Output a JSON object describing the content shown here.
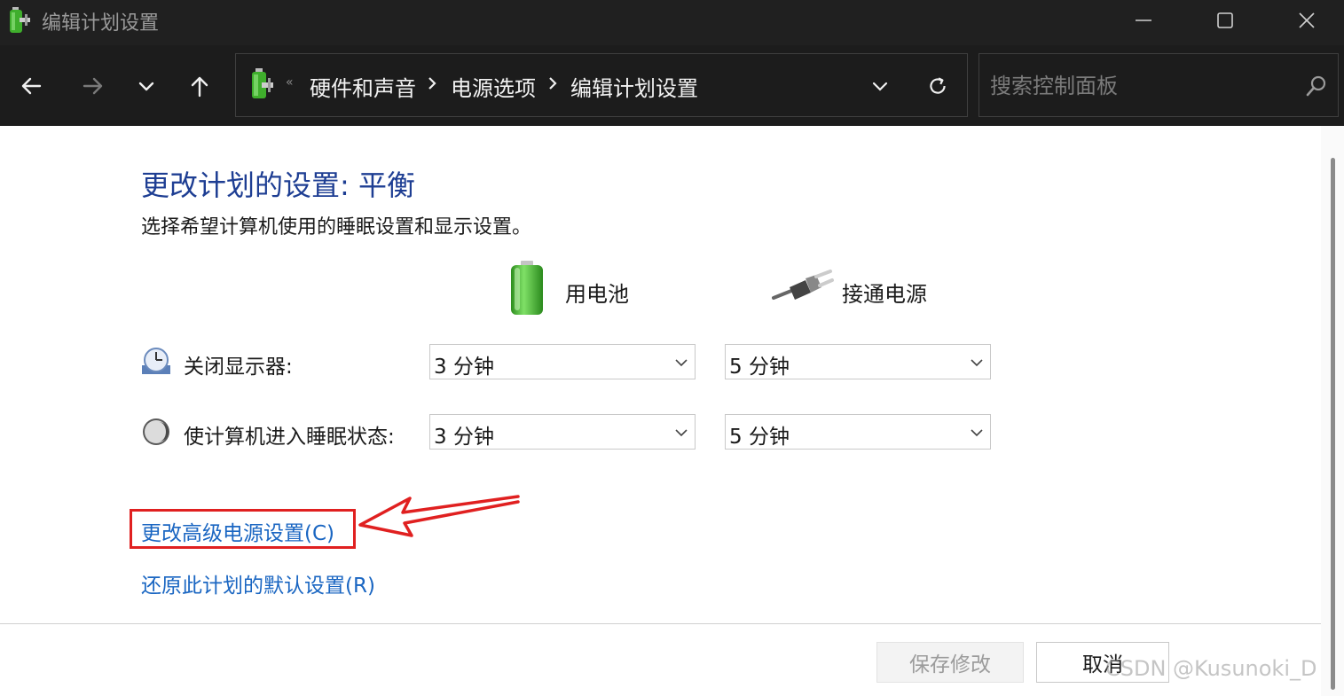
{
  "window": {
    "title": "编辑计划设置"
  },
  "addressbar": {
    "overflow_glyph": "«",
    "breadcrumbs": [
      "硬件和声音",
      "电源选项",
      "编辑计划设置"
    ]
  },
  "search": {
    "placeholder": "搜索控制面板"
  },
  "main": {
    "heading": "更改计划的设置: 平衡",
    "description": "选择希望计算机使用的睡眠设置和显示设置。",
    "columns": {
      "battery": "用电池",
      "plugged": "接通电源"
    },
    "rows": [
      {
        "label": "关闭显示器:",
        "battery": "3 分钟",
        "plugged": "5 分钟"
      },
      {
        "label": "使计算机进入睡眠状态:",
        "battery": "3 分钟",
        "plugged": "5 分钟"
      }
    ],
    "links": {
      "advanced": "更改高级电源设置(C)",
      "restore": "还原此计划的默认设置(R)"
    }
  },
  "footer": {
    "save_label": "保存修改",
    "cancel_label": "取消"
  },
  "watermark": "CSDN @Kusunoki_D",
  "colors": {
    "heading": "#1e3e93",
    "link": "#1a66c2",
    "annotation": "#e02020",
    "titlebar_bg": "#202020",
    "navbar_bg": "#1c1c1c"
  },
  "icons": {
    "app": "battery-plug-icon",
    "battery": "battery-icon",
    "plug": "power-plug-icon",
    "display": "monitor-clock-icon",
    "sleep": "moon-icon"
  }
}
